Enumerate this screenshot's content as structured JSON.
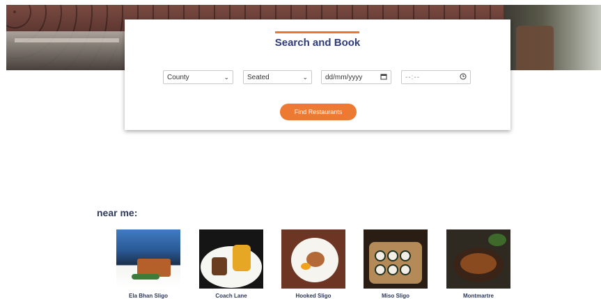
{
  "search": {
    "title": "Search and Book",
    "county": "County",
    "seating": "Seated",
    "date_placeholder": "dd/mm/yyyy",
    "time_placeholder": "--:--",
    "find_button": "Find Restaurants"
  },
  "near_me": {
    "heading": "near me:",
    "restaurants": [
      {
        "name": "Ela Bhan Sligo"
      },
      {
        "name": "Coach Lane"
      },
      {
        "name": "Hooked Sligo"
      },
      {
        "name": "Miso Sligo"
      },
      {
        "name": "Montmartre"
      }
    ]
  },
  "colors": {
    "accent": "#ec7a32",
    "title": "#2f3a78"
  },
  "icons": {
    "select_arrow": "chevron-down-icon",
    "date": "calendar-icon",
    "time": "clock-icon"
  }
}
